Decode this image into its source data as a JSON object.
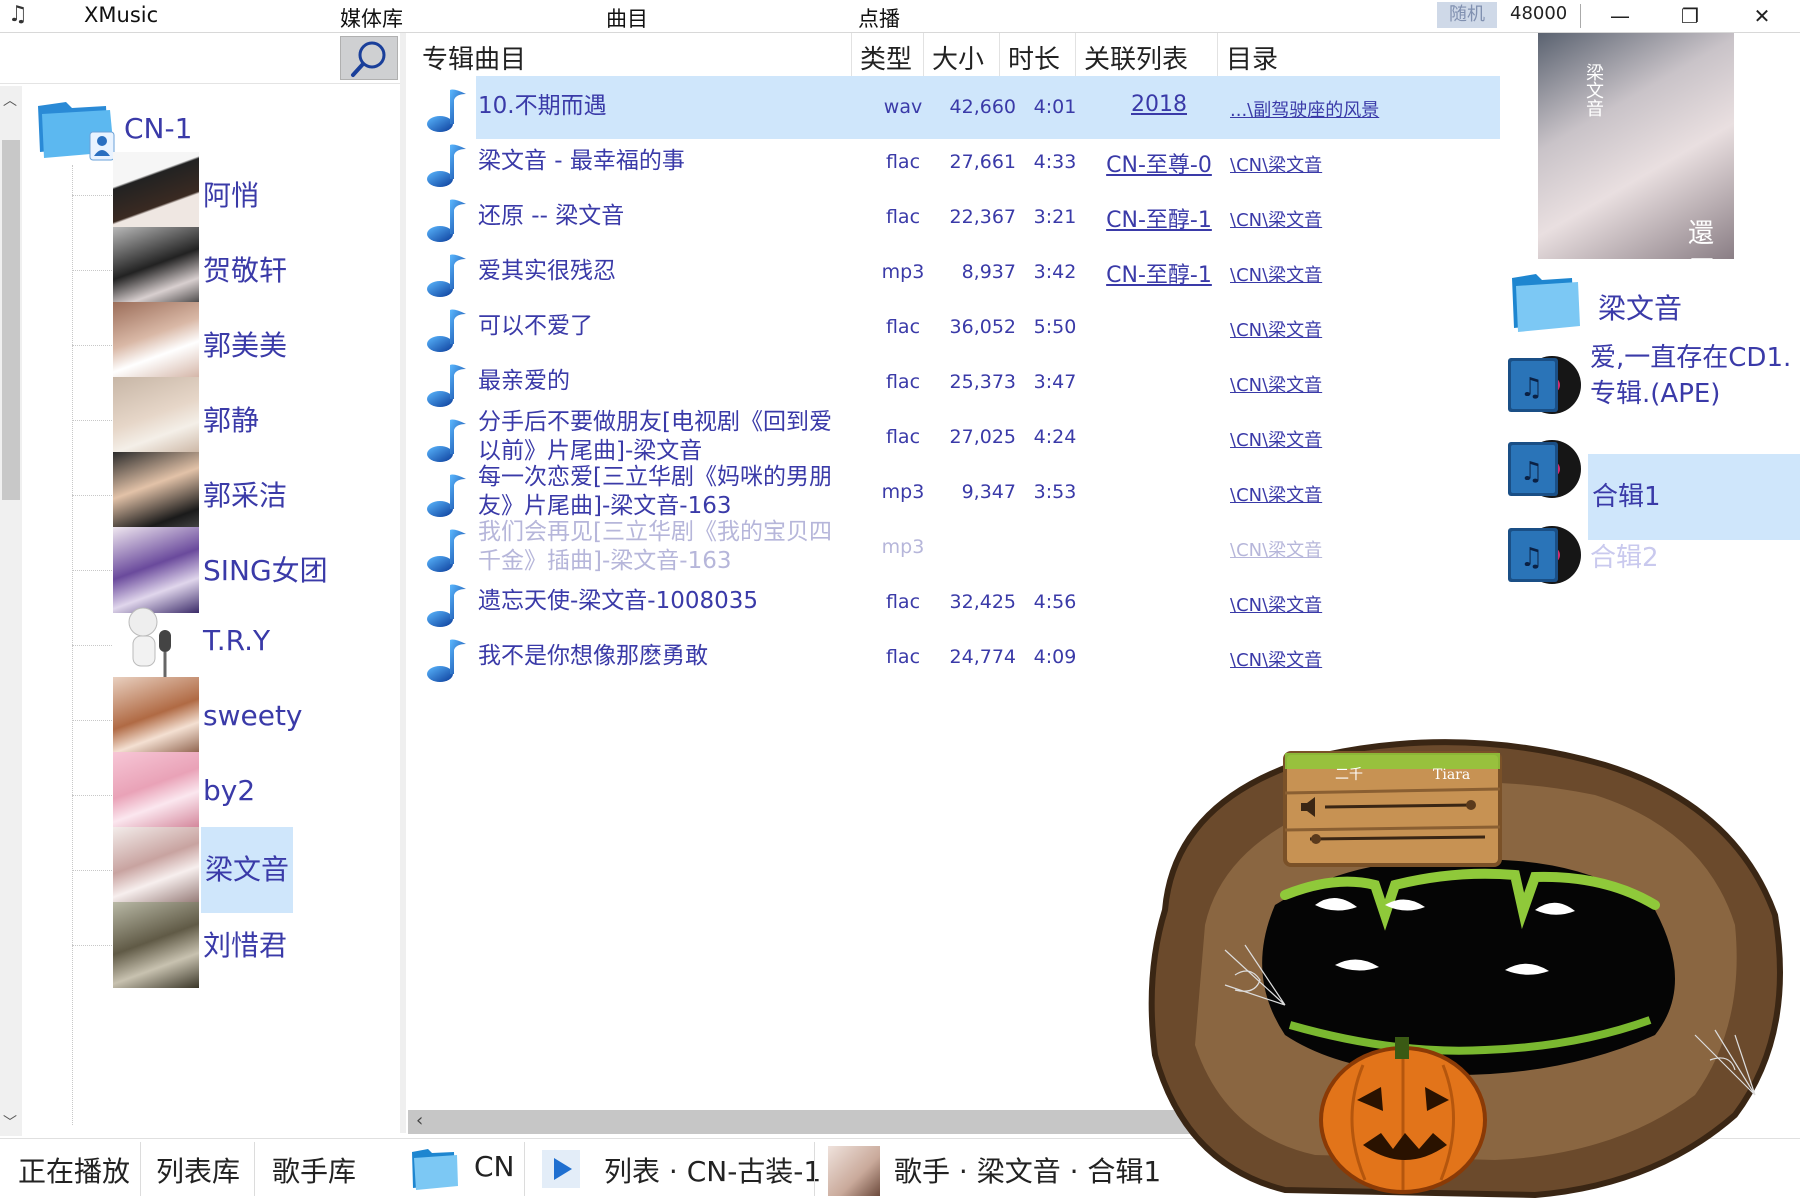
{
  "app": {
    "name": "XMusic"
  },
  "menu": {
    "library": "媒体库",
    "tracks": "曲目",
    "on_demand": "点播"
  },
  "status": {
    "random_label": "随机",
    "sample_rate": "48000"
  },
  "window": {
    "minimize": "—",
    "restore": "❐",
    "close": "✕"
  },
  "sidebar": {
    "root_label": "CN-1",
    "artists": [
      {
        "name": "阿悄"
      },
      {
        "name": "贺敬轩"
      },
      {
        "name": "郭美美"
      },
      {
        "name": "郭静"
      },
      {
        "name": "郭采洁"
      },
      {
        "name": "SING女团"
      },
      {
        "name": "T.R.Y"
      },
      {
        "name": "sweety"
      },
      {
        "name": "by2"
      },
      {
        "name": "梁文音"
      },
      {
        "name": "刘惜君"
      }
    ]
  },
  "tracklist": {
    "headers": {
      "title": "专辑曲目",
      "type": "类型",
      "size": "大小",
      "duration": "时长",
      "related": "关联列表",
      "dir": "目录"
    },
    "rows": [
      {
        "title": "10.不期而遇",
        "type": "wav",
        "size": "42,660",
        "dur": "4:01",
        "rel": "2018",
        "dir": "...\\副驾驶座的风景"
      },
      {
        "title": "梁文音 - 最幸福的事",
        "type": "flac",
        "size": "27,661",
        "dur": "4:33",
        "rel": "CN-至尊-0",
        "dir": "\\CN\\梁文音"
      },
      {
        "title": "还原 -- 梁文音",
        "type": "flac",
        "size": "22,367",
        "dur": "3:21",
        "rel": "CN-至醇-1",
        "dir": "\\CN\\梁文音"
      },
      {
        "title": "爱其实很残忍",
        "type": "mp3",
        "size": "8,937",
        "dur": "3:42",
        "rel": "CN-至醇-1",
        "dir": "\\CN\\梁文音"
      },
      {
        "title": "可以不爱了",
        "type": "flac",
        "size": "36,052",
        "dur": "5:50",
        "rel": "",
        "dir": "\\CN\\梁文音"
      },
      {
        "title": "最亲爱的",
        "type": "flac",
        "size": "25,373",
        "dur": "3:47",
        "rel": "",
        "dir": "\\CN\\梁文音"
      },
      {
        "title": "分手后不要做朋友[电视剧《回到爱以前》片尾曲]-梁文音",
        "type": "flac",
        "size": "27,025",
        "dur": "4:24",
        "rel": "",
        "dir": "\\CN\\梁文音"
      },
      {
        "title": "每一次恋爱[三立华剧《妈咪的男朋友》片尾曲]-梁文音-163",
        "type": "mp3",
        "size": "9,347",
        "dur": "3:53",
        "rel": "",
        "dir": "\\CN\\梁文音"
      },
      {
        "title": "我们会再见[三立华剧《我的宝贝四千金》插曲]-梁文音-163",
        "type": "mp3",
        "size": "",
        "dur": "",
        "rel": "",
        "dir": "\\CN\\梁文音"
      },
      {
        "title": "遗忘天使-梁文音-1008035",
        "type": "flac",
        "size": "32,425",
        "dur": "4:56",
        "rel": "",
        "dir": "\\CN\\梁文音"
      },
      {
        "title": "我不是你想像那麽勇敢",
        "type": "flac",
        "size": "24,774",
        "dur": "4:09",
        "rel": "",
        "dir": "\\CN\\梁文音"
      }
    ]
  },
  "rightpanel": {
    "cover_text": "還原",
    "cover_artist": "梁文音",
    "artist_folder": "梁文音",
    "albums": [
      {
        "label": "爱,一直存在CD1.专辑.(APE)"
      },
      {
        "label": "合辑1"
      },
      {
        "label": "合辑2"
      }
    ]
  },
  "widget": {
    "left_label": "二千",
    "right_label": "Tiara"
  },
  "bottom": {
    "tabs": [
      "正在播放",
      "列表库",
      "歌手库"
    ],
    "crumbs": [
      "CN",
      "列表 · CN-古装-1",
      "歌手 · 梁文音 · 合辑1"
    ]
  },
  "colors": {
    "accent_text": "#3a3aa8",
    "selection": "#cfe6fb"
  }
}
